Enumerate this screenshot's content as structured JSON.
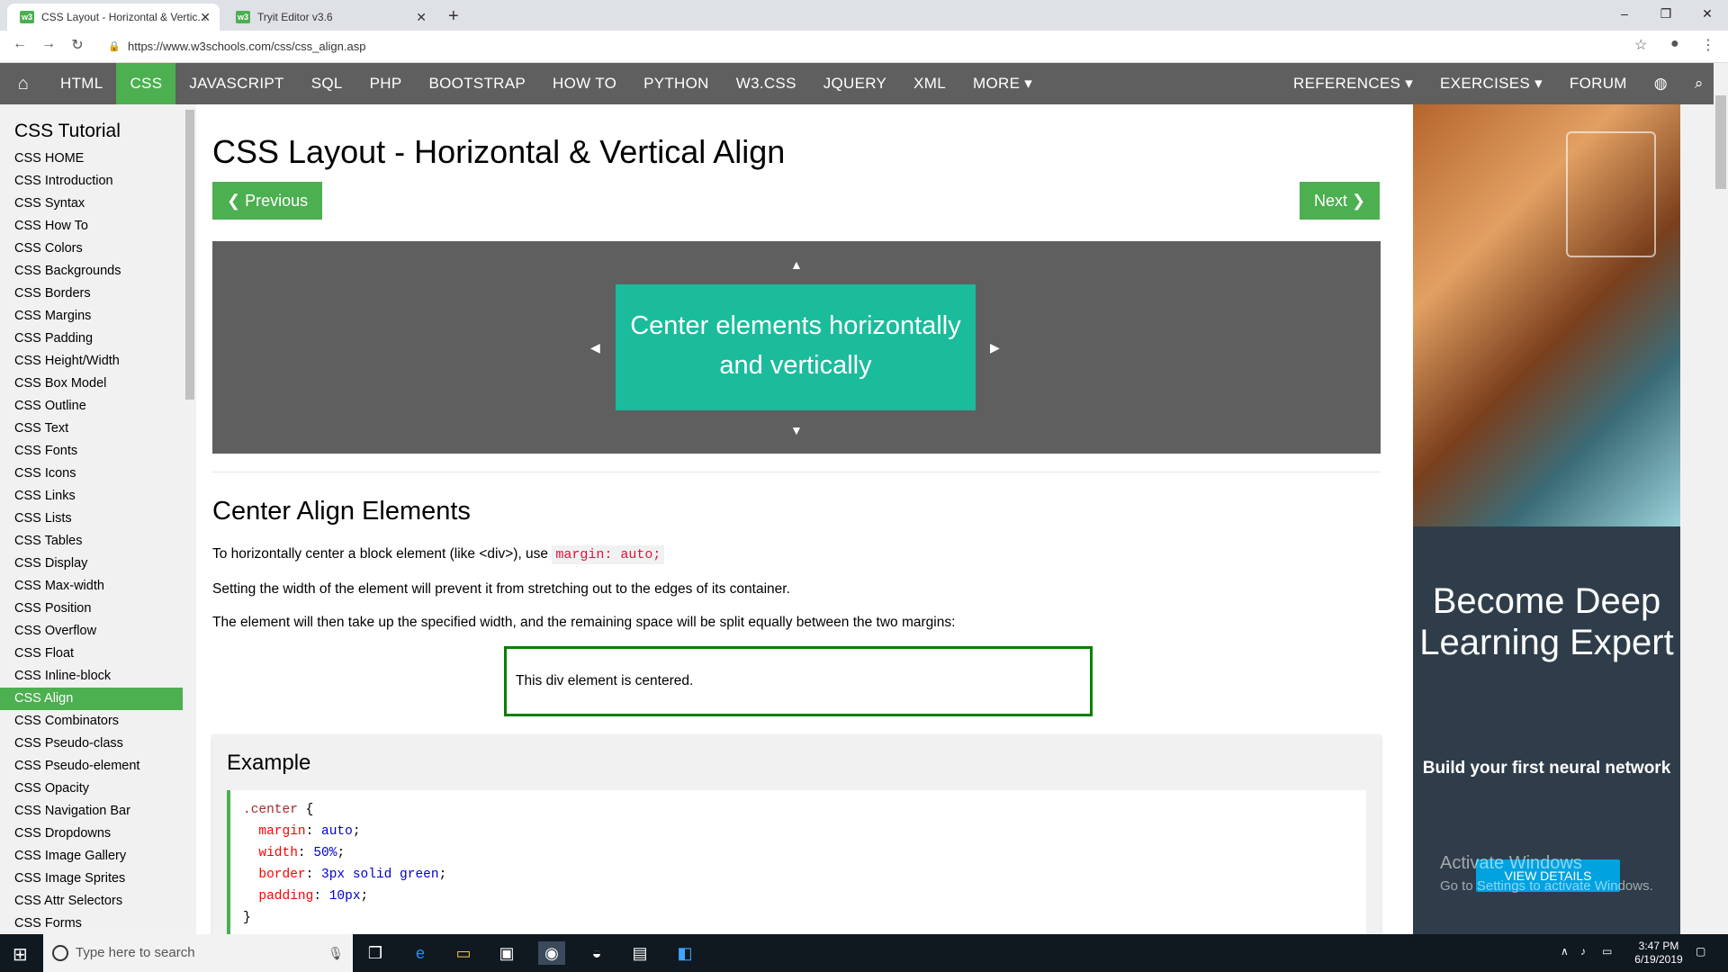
{
  "browser": {
    "tabs": [
      {
        "title": "CSS Layout - Horizontal & Vertic...",
        "favicon": "w3"
      },
      {
        "title": "Tryit Editor v3.6",
        "favicon": "w3"
      }
    ],
    "url": "https://www.w3schools.com/css/css_align.asp"
  },
  "topnav": {
    "items": [
      "HTML",
      "CSS",
      "JAVASCRIPT",
      "SQL",
      "PHP",
      "BOOTSTRAP",
      "HOW TO",
      "PYTHON",
      "W3.CSS",
      "JQUERY",
      "XML",
      "MORE ▾"
    ],
    "active": "CSS",
    "right": [
      "REFERENCES ▾",
      "EXERCISES ▾",
      "FORUM"
    ]
  },
  "sidebar": {
    "heading": "CSS Tutorial",
    "links": [
      "CSS HOME",
      "CSS Introduction",
      "CSS Syntax",
      "CSS How To",
      "CSS Colors",
      "CSS Backgrounds",
      "CSS Borders",
      "CSS Margins",
      "CSS Padding",
      "CSS Height/Width",
      "CSS Box Model",
      "CSS Outline",
      "CSS Text",
      "CSS Fonts",
      "CSS Icons",
      "CSS Links",
      "CSS Lists",
      "CSS Tables",
      "CSS Display",
      "CSS Max-width",
      "CSS Position",
      "CSS Overflow",
      "CSS Float",
      "CSS Inline-block",
      "CSS Align",
      "CSS Combinators",
      "CSS Pseudo-class",
      "CSS Pseudo-element",
      "CSS Opacity",
      "CSS Navigation Bar",
      "CSS Dropdowns",
      "CSS Image Gallery",
      "CSS Image Sprites",
      "CSS Attr Selectors",
      "CSS Forms"
    ],
    "active": "CSS Align"
  },
  "main": {
    "title": "CSS Layout - Horizontal & Vertical Align",
    "prev_label": "❮ Previous",
    "next_label": "Next ❯",
    "demo_text": "Center elements horizontally and vertically",
    "section_heading": "Center Align Elements",
    "para1_before": "To horizontally center a block element (like <div>), use",
    "para1_code": "margin: auto;",
    "para2": "Setting the width of the element will prevent it from stretching out to the edges of its container.",
    "para3": "The element will then take up the specified width, and the remaining space will be split equally between the two margins:",
    "centered_div_text": "This div element is centered.",
    "example_heading": "Example",
    "code": {
      "selector": ".center",
      "lines": [
        {
          "prop": "margin",
          "val": "auto"
        },
        {
          "prop": "width",
          "val": "50%"
        },
        {
          "prop": "border",
          "val": "3px solid green"
        },
        {
          "prop": "padding",
          "val": "10px"
        }
      ]
    }
  },
  "ad": {
    "headline": "Become Deep Learning Expert",
    "subline": "Build your first neural network",
    "cta": "VIEW DETAILS"
  },
  "watermark": {
    "line1": "Activate Windows",
    "line2": "Go to Settings to activate Windows."
  },
  "taskbar": {
    "search_placeholder": "Type here to search",
    "time": "3:47 PM",
    "date": "6/19/2019"
  }
}
